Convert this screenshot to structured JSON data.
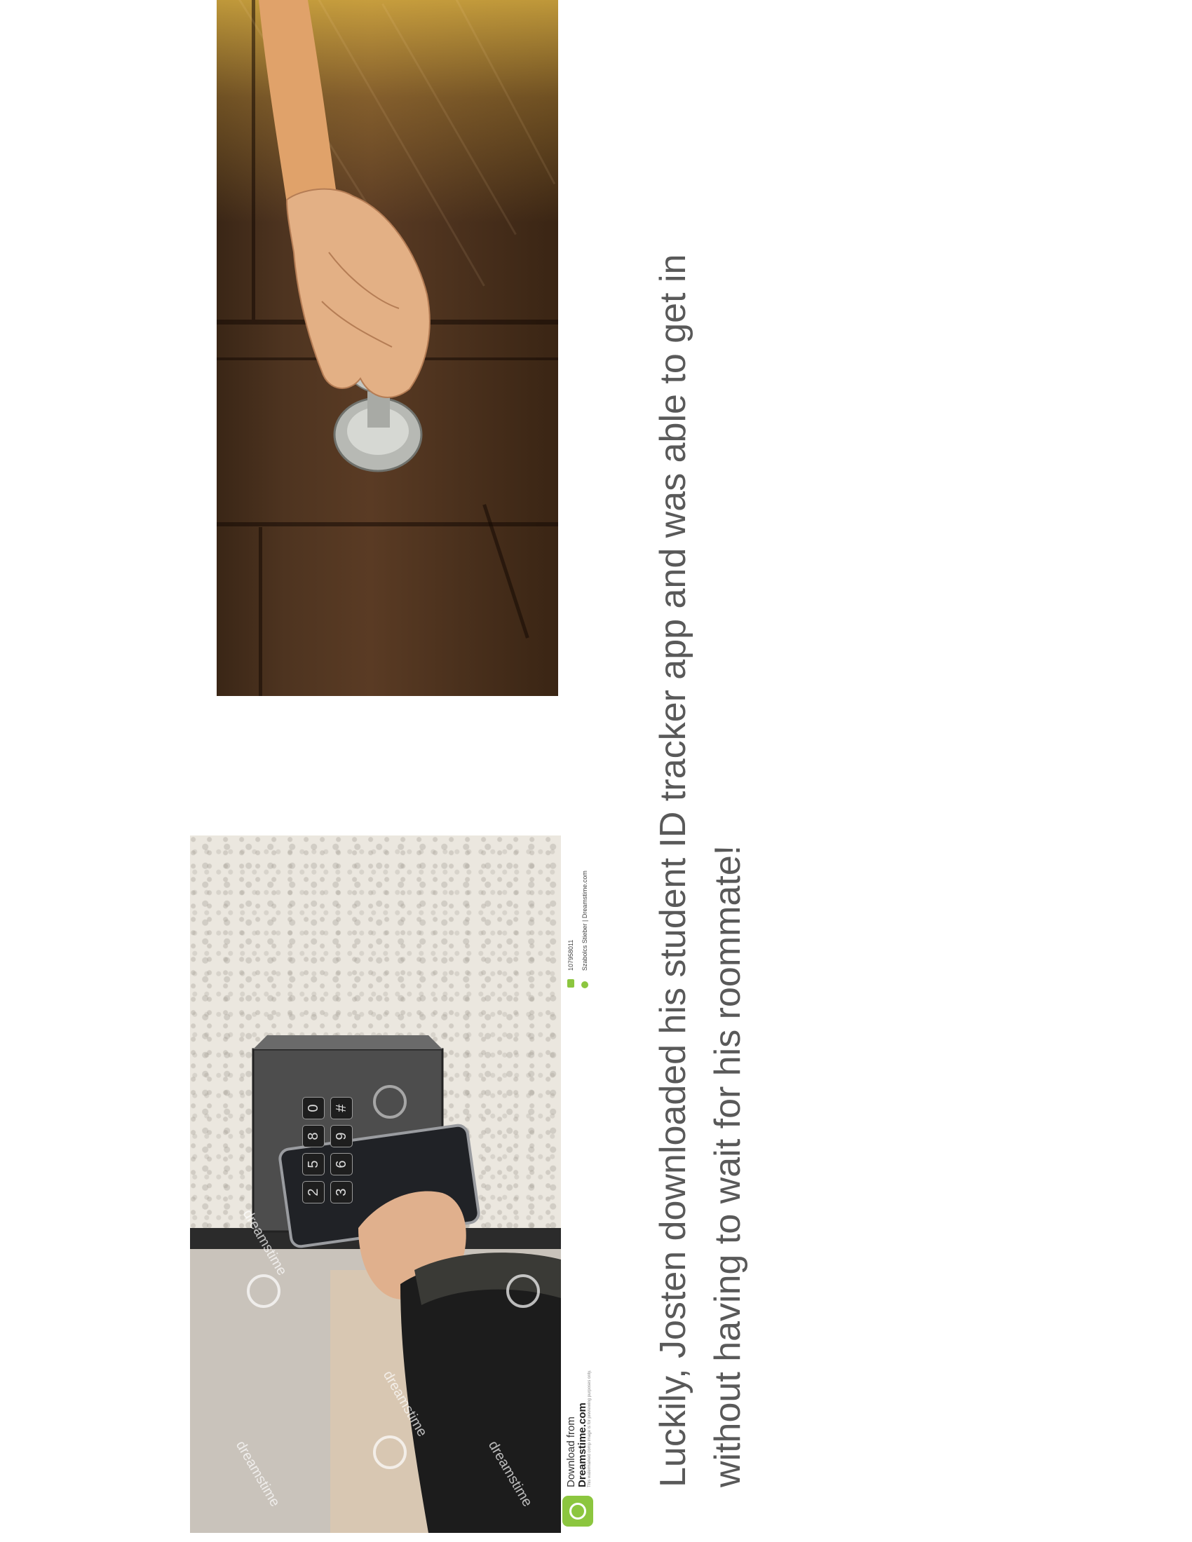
{
  "caption": {
    "line1": "Luckily, Josten downloaded his student ID tracker app and was able to get in",
    "line2": "without having to wait for his roommate!"
  },
  "keypad_photo": {
    "keys": [
      "2",
      "3",
      "5",
      "6",
      "8",
      "9",
      "0",
      "#"
    ],
    "watermark_text": "dreamstime",
    "stock_footer": {
      "download_from": "Download from",
      "site": "Dreamstime.com",
      "disclaimer": "This watermarked comp image is for previewing purposes only.",
      "image_id": "107958011",
      "credit": "Szabolcs Stieber | Dreamstime.com"
    }
  },
  "colors": {
    "caption_text": "#595959",
    "dreamstime_green": "#8cc63f",
    "wood": "#4e3420"
  }
}
